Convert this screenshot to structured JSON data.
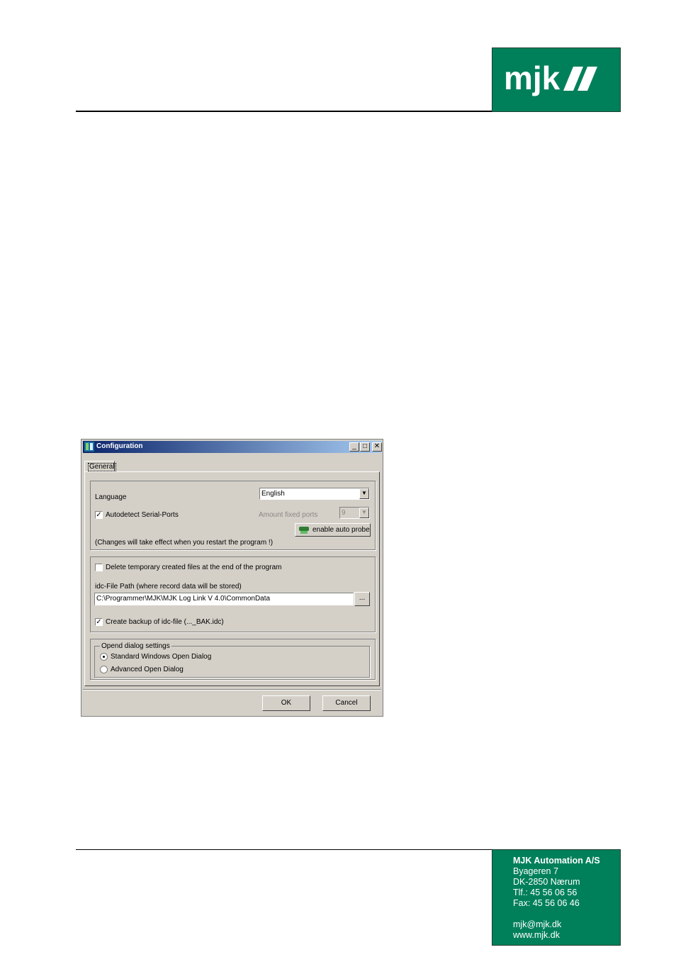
{
  "logo": {
    "text": "mjk",
    "bg_color": "#00805a"
  },
  "dialog": {
    "title": "Configuration",
    "window_buttons": {
      "minimize": "_",
      "maximize": "□",
      "close": "✕"
    },
    "tab_general": "General",
    "language_label": "Language",
    "language_value": "English",
    "autodetect_label": "Autodetect Serial-Ports",
    "autodetect_checked": "✓",
    "amount_fixed_ports_label": "Amount fixed ports",
    "amount_fixed_ports_value": "9",
    "enable_auto_probe_label": "enable auto probe",
    "restart_note": "(Changes will take effect when you restart the program !)",
    "delete_temp_label": "Delete temporary created files at the end of the program",
    "idc_path_label": "idc-File Path (where record data will be stored)",
    "idc_path_value": "C:\\Programmer\\MJK\\MJK Log Link V 4.0\\CommonData",
    "browse_label": "...",
    "backup_label": "Create backup of idc-file (..._BAK.idc)",
    "backup_checked": "✓",
    "open_dialog_legend": "Opend dialog settings",
    "radio_standard": "Standard Windows Open Dialog",
    "radio_advanced": "Advanced Open Dialog",
    "ok_label": "OK",
    "cancel_label": "Cancel"
  },
  "footer": {
    "company": "MJK Automation A/S",
    "street": "Byageren 7",
    "city": "DK-2850 Nærum",
    "phone": "Tlf.:  45 56 06 56",
    "fax": "Fax:  45 56 06 46",
    "email": "mjk@mjk.dk",
    "web": "www.mjk.dk"
  }
}
